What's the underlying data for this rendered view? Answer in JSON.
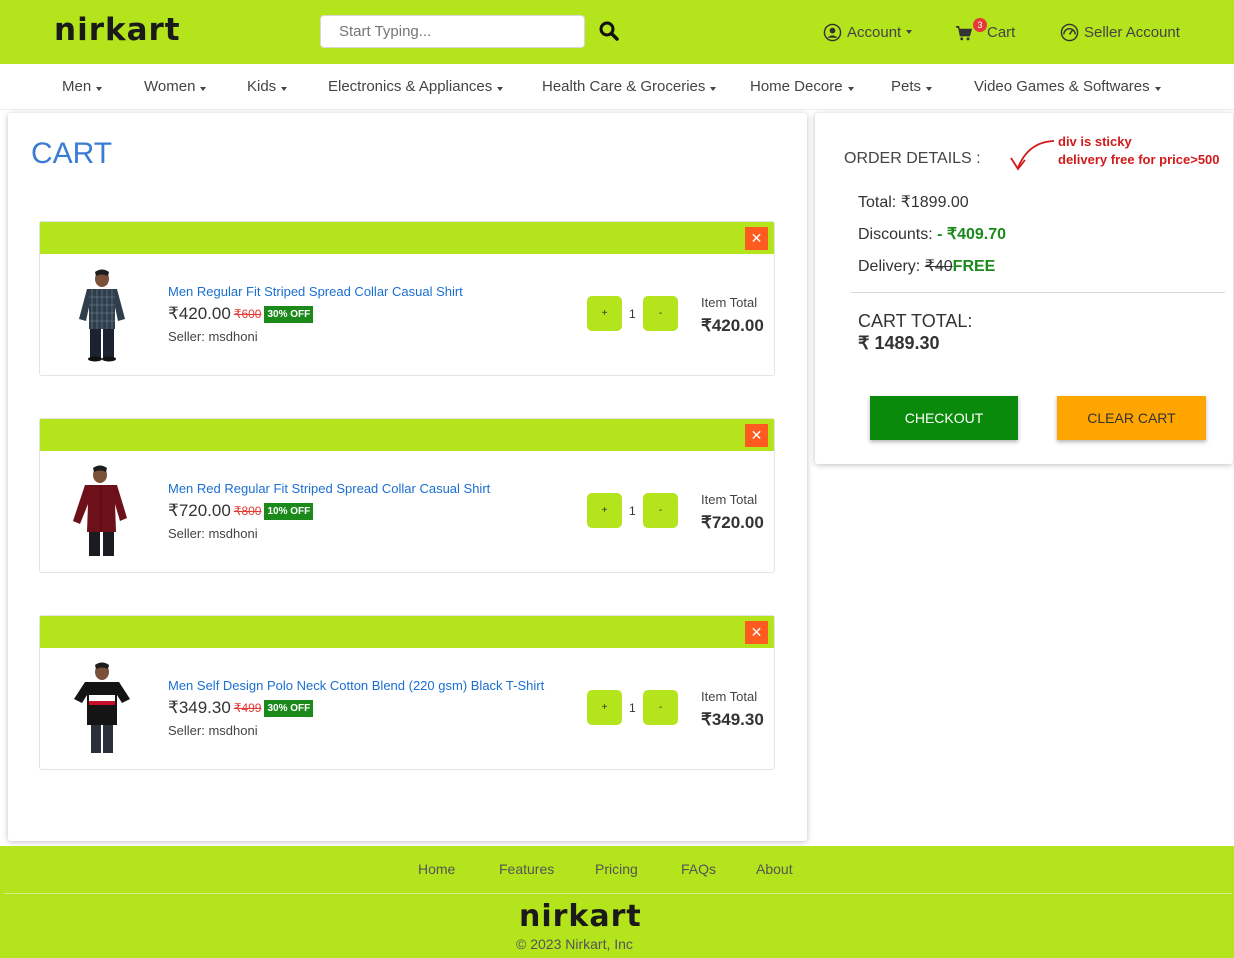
{
  "header": {
    "logo": "nirkart",
    "search_placeholder": "Start Typing...",
    "account_label": "Account",
    "cart_label": "Cart",
    "cart_count": "3",
    "seller_label": "Seller Account",
    "brand_color": "#b3e41c"
  },
  "nav": {
    "items": [
      {
        "label": "Men"
      },
      {
        "label": "Women"
      },
      {
        "label": "Kids"
      },
      {
        "label": "Electronics & Appliances"
      },
      {
        "label": "Health Care & Groceries"
      },
      {
        "label": "Home Decore"
      },
      {
        "label": "Pets"
      },
      {
        "label": "Video Games & Softwares"
      }
    ]
  },
  "cart": {
    "title": "CART",
    "remove_icon": "close-icon",
    "plus_label": "+",
    "minus_label": "-",
    "item_total_label": "Item Total",
    "items": [
      {
        "name": "Men Regular Fit Striped Spread Collar Casual Shirt",
        "price": "₹420.00",
        "mrp": "₹600",
        "discount": "30% OFF",
        "seller": "Seller: msdhoni",
        "qty": "1",
        "item_total": "₹420.00"
      },
      {
        "name": "Men Red Regular Fit Striped Spread Collar Casual Shirt",
        "price": "₹720.00",
        "mrp": "₹800",
        "discount": "10% OFF",
        "seller": "Seller: msdhoni",
        "qty": "1",
        "item_total": "₹720.00"
      },
      {
        "name": "Men Self Design Polo Neck Cotton Blend (220 gsm) Black T-Shirt",
        "price": "₹349.30",
        "mrp": "₹499",
        "discount": "30% OFF",
        "seller": "Seller: msdhoni",
        "qty": "1",
        "item_total": "₹349.30"
      }
    ]
  },
  "order": {
    "title": "ORDER DETAILS :",
    "total_label": "Total: ",
    "total_value": "₹1899.00",
    "discounts_label": "Discounts: ",
    "discounts_value": "- ₹409.70",
    "delivery_label": "Delivery: ",
    "delivery_original": "₹40",
    "delivery_value": "FREE",
    "cart_total_label": "CART TOTAL:",
    "cart_total_value": "₹ 1489.30",
    "checkout_label": "CHECKOUT",
    "clear_label": "CLEAR CART",
    "note_line1": "div is sticky",
    "note_line2": "delivery free for price>500"
  },
  "footer": {
    "links": [
      {
        "label": "Home"
      },
      {
        "label": "Features"
      },
      {
        "label": "Pricing"
      },
      {
        "label": "FAQs"
      },
      {
        "label": "About"
      }
    ],
    "logo": "nirkart",
    "copyright": "© 2023 Nirkart, Inc"
  }
}
